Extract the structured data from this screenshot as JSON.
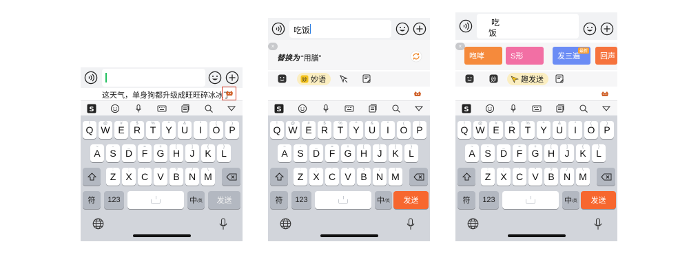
{
  "keyboard": {
    "row1": [
      "Q",
      "W",
      "E",
      "R",
      "T",
      "Y",
      "U",
      "I",
      "O",
      "P"
    ],
    "row1_hints": [
      "!",
      "@",
      "#",
      "$",
      "%",
      "^",
      "&",
      "*",
      "(",
      ")"
    ],
    "row2": [
      "A",
      "S",
      "D",
      "F",
      "G",
      "H",
      "J",
      "K",
      "L"
    ],
    "row2_hints": [
      "~",
      "-",
      "_",
      "=",
      "+",
      "[",
      "]",
      "{",
      "}"
    ],
    "row3": [
      "Z",
      "X",
      "C",
      "V",
      "B",
      "N",
      "M"
    ],
    "row3_hints": [
      ":",
      ";",
      "'",
      "\"",
      "?",
      "/",
      "\\"
    ],
    "symbols_key": "符",
    "numbers_key": "123",
    "lang_key": "中",
    "lang_key_sub": "/英",
    "send_key": "发送"
  },
  "panels": [
    {
      "input_text": "",
      "candidate_text": "这天气，单身狗都升级成旺旺碎冰冰了",
      "send_active": false
    },
    {
      "input_text": "吃饭",
      "suggestion_prefix": "替换为",
      "suggestion_value": "“用膳”",
      "chip_label": "妙语",
      "send_active": true
    },
    {
      "input_text_line1": "吃",
      "input_text_line2": "饭",
      "stickers": [
        {
          "label": "咆哮",
          "color": "#f58a3c"
        },
        {
          "label": "S形",
          "color": "#f26fa4"
        },
        {
          "label": "发三遍",
          "color": "#6b8cf5",
          "tag": "最新"
        },
        {
          "label": "回声",
          "color": "#f6733d"
        }
      ],
      "chip_label": "趣发送",
      "send_active": true
    }
  ],
  "colors": {
    "accent_send": "#f7672f",
    "keyboard_bg": "#d2d5db",
    "cursor": "#23c060",
    "highlight_box": "#d9412e"
  }
}
